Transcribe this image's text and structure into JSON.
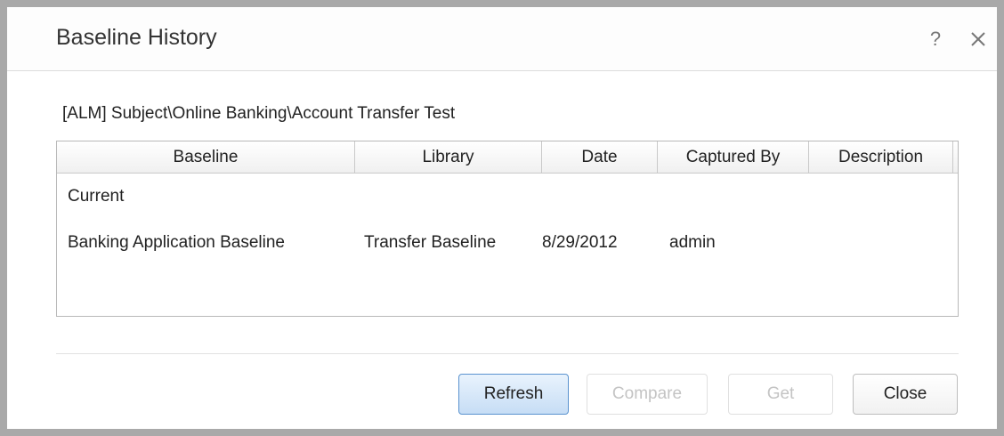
{
  "dialog": {
    "title": "Baseline History",
    "help_icon": "question-mark-icon",
    "close_icon": "close-icon"
  },
  "path": "[ALM] Subject\\Online Banking\\Account Transfer Test",
  "grid": {
    "columns": [
      "Baseline",
      "Library",
      "Date",
      "Captured By",
      "Description"
    ],
    "rows": [
      {
        "baseline": "Current",
        "library": "",
        "date": "",
        "captured_by": "",
        "description": ""
      },
      {
        "baseline": "Banking Application Baseline",
        "library": "Transfer Baseline",
        "date": "8/29/2012",
        "captured_by": "admin",
        "description": ""
      }
    ]
  },
  "buttons": {
    "refresh": "Refresh",
    "compare": "Compare",
    "get": "Get",
    "close": "Close"
  },
  "colors": {
    "primary_button_border": "#5b93cf",
    "disabled_text": "#c4c4c4"
  }
}
